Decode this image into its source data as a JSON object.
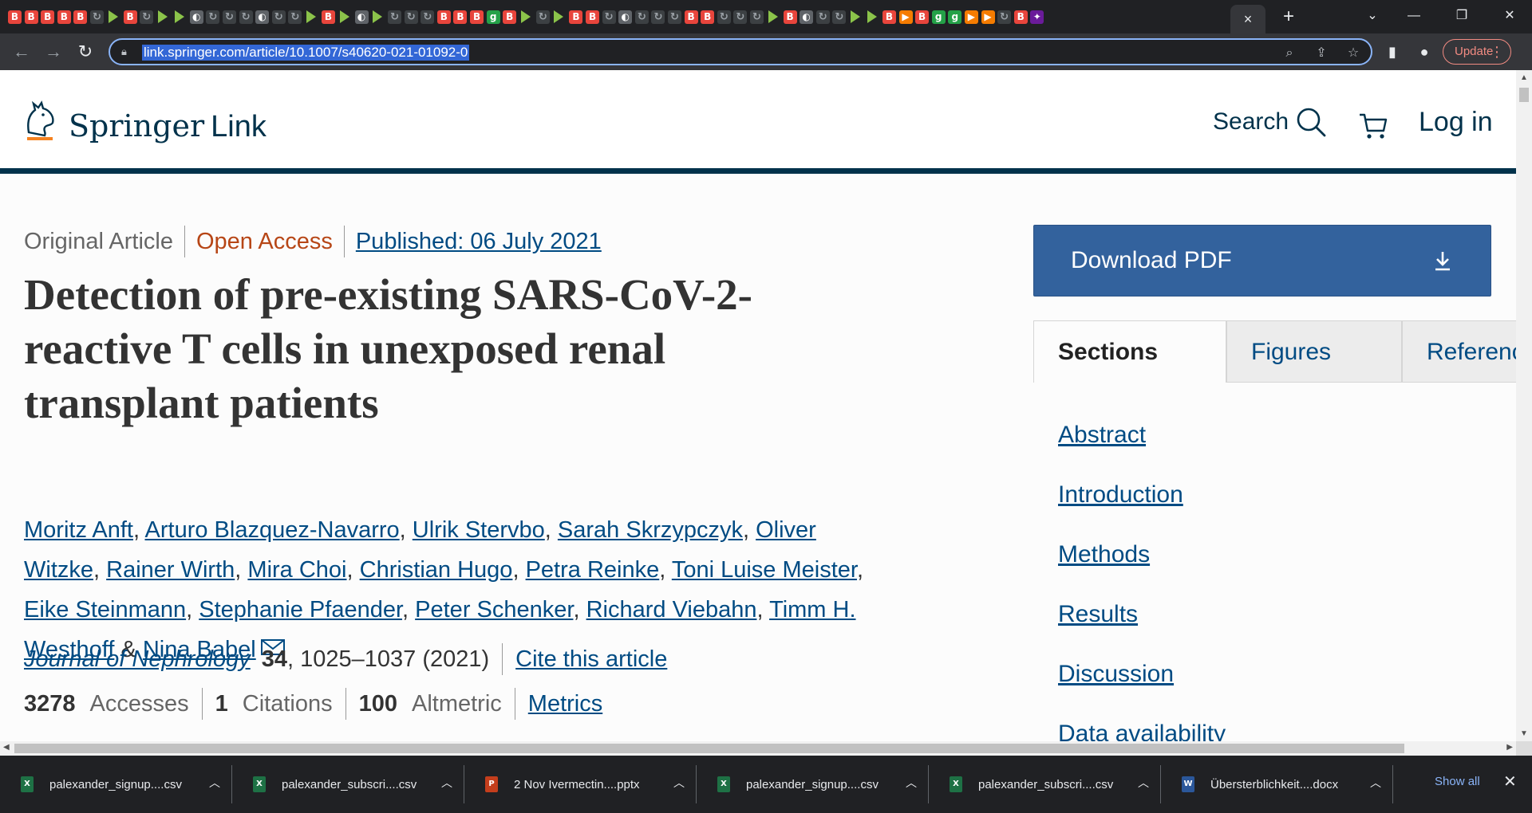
{
  "browser": {
    "tab_icons": [
      "b",
      "b",
      "b",
      "b",
      "b",
      "g",
      "p",
      "b",
      "g",
      "p",
      "p",
      "c",
      "g",
      "g",
      "g",
      "c",
      "g",
      "g",
      "p",
      "b",
      "p",
      "c",
      "p",
      "g",
      "g",
      "g",
      "b",
      "b",
      "b",
      "y",
      "b",
      "p",
      "g",
      "p",
      "b",
      "b",
      "g",
      "c",
      "g",
      "g",
      "g",
      "b",
      "b",
      "g",
      "g",
      "g",
      "p",
      "b",
      "c",
      "g",
      "g",
      "p",
      "p",
      "b",
      "o",
      "b",
      "y",
      "y",
      "o",
      "o",
      "g",
      "b",
      "v"
    ],
    "active_tab_close": "×",
    "new_tab": "+",
    "url": "link.springer.com/article/10.1007/s40620-021-01092-0",
    "update_label": "Update"
  },
  "header": {
    "logo_word": "Springer",
    "logo_link": "Link",
    "search_label": "Search",
    "login_label": "Log in"
  },
  "article": {
    "type": "Original Article",
    "access": "Open Access",
    "published": "Published: 06 July 2021",
    "title": "Detection of pre-existing SARS-CoV-2-reactive T cells in unexposed renal transplant patients",
    "authors": [
      "Moritz Anft",
      "Arturo Blazquez-Navarro",
      "Ulrik Stervbo",
      "Sarah Skrzypczyk",
      "Oliver Witzke",
      "Rainer Wirth",
      "Mira Choi",
      "Christian Hugo",
      "Petra Reinke",
      "Toni Luise Meister",
      "Eike Steinmann",
      "Stephanie Pfaender",
      "Peter Schenker",
      "Richard Viebahn",
      "Timm H. Westhoff",
      "Nina Babel"
    ],
    "journal": "Journal of Nephrology",
    "volume": "34",
    "pages_year": ", 1025–1037 (2021)",
    "cite_label": "Cite this article",
    "accesses_num": "3278",
    "accesses_label": "Accesses",
    "citations_num": "1",
    "citations_label": "Citations",
    "altmetric_num": "100",
    "altmetric_label": "Altmetric",
    "metrics_label": "Metrics"
  },
  "sidebar": {
    "download_label": "Download PDF",
    "tabs": [
      "Sections",
      "Figures",
      "References"
    ],
    "sections": [
      "Abstract",
      "Introduction",
      "Methods",
      "Results",
      "Discussion",
      "Data availability"
    ]
  },
  "downloads": {
    "items": [
      {
        "name": "palexander_signup....csv",
        "type": "xls",
        "color": "#1e7145"
      },
      {
        "name": "palexander_subscri....csv",
        "type": "xls",
        "color": "#1e7145"
      },
      {
        "name": "2 Nov Ivermectin....pptx",
        "type": "ppt",
        "color": "#c43e1c"
      },
      {
        "name": "palexander_signup....csv",
        "type": "xls",
        "color": "#1e7145"
      },
      {
        "name": "palexander_subscri....csv",
        "type": "xls",
        "color": "#1e7145"
      },
      {
        "name": "Übersterblichkeit....docx",
        "type": "doc",
        "color": "#2b579a"
      }
    ],
    "show_all": "Show all"
  }
}
